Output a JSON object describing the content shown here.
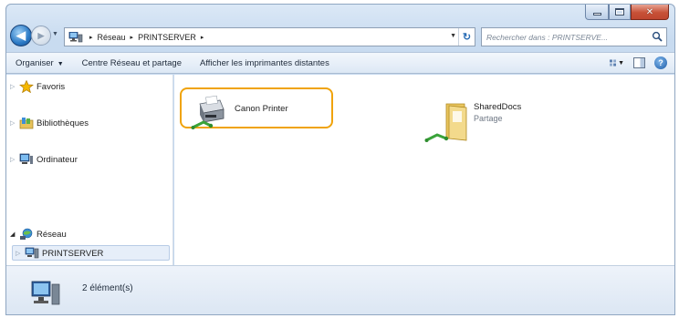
{
  "window": {
    "caption": {
      "minimize_icon": "minimize-icon",
      "maximize_icon": "maximize-icon",
      "close_icon": "close-icon",
      "close_color": "#c75137"
    }
  },
  "address_bar": {
    "segments": [
      "Réseau",
      "PRINTSERVER"
    ],
    "separator": "▸",
    "search_placeholder": "Rechercher dans : PRINTSERVE..."
  },
  "toolbar": {
    "organize_label": "Organiser",
    "network_center_label": "Centre Réseau et partage",
    "remote_printers_label": "Afficher les imprimantes distantes"
  },
  "nav_pane": {
    "items": [
      {
        "label": "Favoris",
        "icon": "star-icon"
      },
      {
        "label": "Bibliothèques",
        "icon": "libraries-icon"
      },
      {
        "label": "Ordinateur",
        "icon": "computer-icon"
      },
      {
        "label": "Réseau",
        "icon": "network-icon"
      },
      {
        "label": "PRINTSERVER",
        "icon": "server-icon",
        "selected": true
      }
    ]
  },
  "content": {
    "items": [
      {
        "name": "Canon Printer",
        "subtitle": "",
        "icon": "shared-printer-icon",
        "highlighted": true,
        "highlight_color": "#f0a30a"
      },
      {
        "name": "SharedDocs",
        "subtitle": "Partage",
        "icon": "shared-folder-icon"
      }
    ]
  },
  "details_pane": {
    "count_text": "2 élément(s)",
    "icon": "server-icon"
  }
}
